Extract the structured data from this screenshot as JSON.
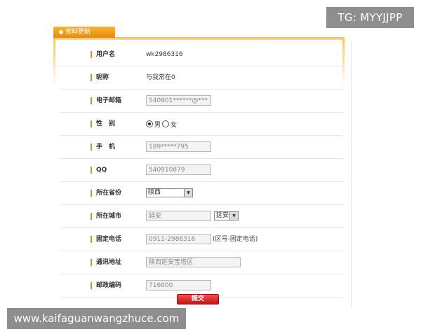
{
  "overlay": {
    "tg_badge": "TG: MYYJJPP",
    "watermark": "www.kaifaguanwangzhuce.com"
  },
  "tab": {
    "title": "资料更新"
  },
  "form": {
    "username": {
      "label": "用户名",
      "value": "wk2986316"
    },
    "nickname": {
      "label": "昵称",
      "value": "与我常在0"
    },
    "email": {
      "label": "电子邮箱",
      "value": "540901******@***"
    },
    "gender": {
      "label": "性　别",
      "options": [
        "男",
        "女"
      ],
      "selected": "男"
    },
    "mobile": {
      "label": "手　机",
      "value": "189*****795"
    },
    "qq": {
      "label": "QQ",
      "value": "540910879"
    },
    "province": {
      "label": "所在省份",
      "selected": "陕西"
    },
    "city": {
      "label": "所在城市",
      "value": "延安",
      "selected": "延安"
    },
    "phone": {
      "label": "固定电话",
      "value": "0911-2986316",
      "hint": "(区号-固定电话)"
    },
    "address": {
      "label": "通讯地址",
      "value": "陕西延安宝塔区"
    },
    "postcode": {
      "label": "邮政编码",
      "value": "716000"
    },
    "submit_label": "提交"
  },
  "colors": {
    "accent": "#e88a16",
    "submit": "#d42020",
    "overlay": "#8e8e8e"
  }
}
